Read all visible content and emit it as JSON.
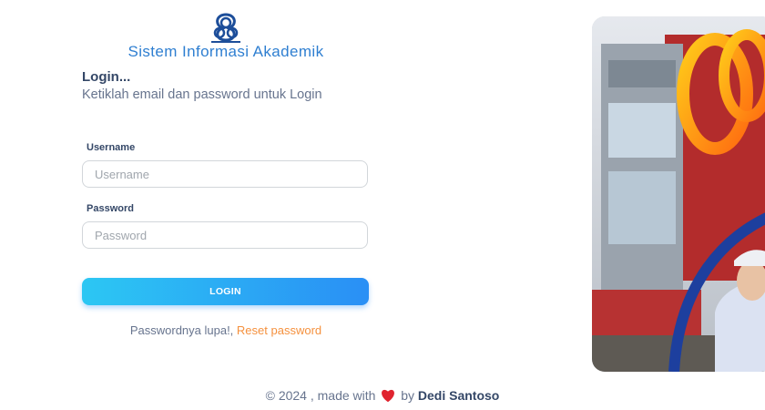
{
  "brand": {
    "logo": "institute-logo-icon",
    "title": "Sistem Informasi Akademik"
  },
  "login": {
    "heading": "Login...",
    "description": "Ketiklah email dan password untuk Login",
    "username": {
      "label": "Username",
      "placeholder": "Username",
      "value": ""
    },
    "password": {
      "label": "Password",
      "placeholder": "Password",
      "value": ""
    },
    "button_label": "LOGIN",
    "forgot_text": "Passwordnya lupa!,",
    "reset_link": "Reset password"
  },
  "hero": {
    "image": "campus-building-photo"
  },
  "footer": {
    "copyright": "© 2024 , made with",
    "heart": "heart-icon",
    "by": "by",
    "author": "Dedi Santoso"
  },
  "colors": {
    "primary": "#2a8ff5",
    "accent": "#f5913e",
    "title": "#2f7fd1",
    "heart": "#e0242f"
  }
}
